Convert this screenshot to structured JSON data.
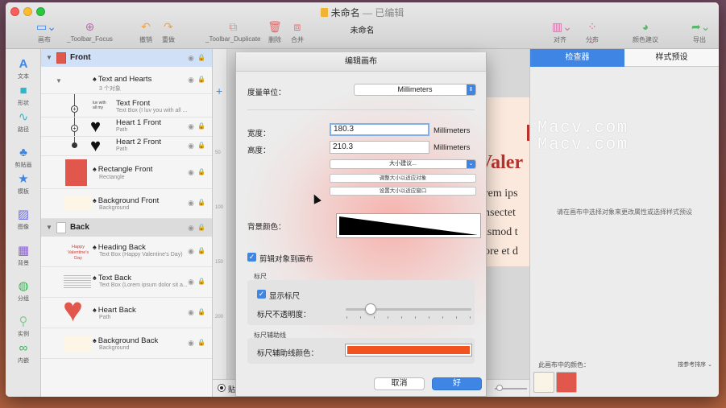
{
  "window": {
    "title": "未命名",
    "title_status": "— 已编辑",
    "doc_name": "未命名"
  },
  "toolbar": {
    "canvas": "画布",
    "focus": "_Toolbar_Focus",
    "undo": "撤销",
    "redo": "重做",
    "duplicate": "_Toolbar_Duplicate",
    "delete": "删除",
    "merge": "合并",
    "align": "对齐",
    "distribute": "分布",
    "color_suggest": "颜色建议",
    "export": "导出"
  },
  "rail": [
    {
      "label": "文本",
      "icon": "text-icon"
    },
    {
      "label": "形状",
      "icon": "shape-icon"
    },
    {
      "label": "路径",
      "icon": "path-icon"
    },
    {
      "label": "剪贴画",
      "icon": "clipart-icon"
    },
    {
      "label": "模板",
      "icon": "template-icon"
    },
    {
      "label": "图像",
      "icon": "image-icon"
    },
    {
      "label": "背景",
      "icon": "background-icon"
    },
    {
      "label": "分组",
      "icon": "group-icon"
    },
    {
      "label": "实例",
      "icon": "instance-icon"
    },
    {
      "label": "内嵌",
      "icon": "embed-icon"
    }
  ],
  "layers": {
    "front_group": "Front",
    "text_and_hearts": {
      "name": "Text and Hearts",
      "type": "3 个对象"
    },
    "text_front": {
      "name": "Text Front",
      "type": "Text Box (I luv you  with  all ..."
    },
    "heart1_front": {
      "name": "Heart 1 Front",
      "type": "Path"
    },
    "heart2_front": {
      "name": "Heart 2 Front",
      "type": "Path"
    },
    "rect_front": {
      "name": "Rectangle Front",
      "type": "Rectangle"
    },
    "bg_front": {
      "name": "Background Front",
      "type": "Background"
    },
    "back_group": "Back",
    "heading_back": {
      "name": "Heading Back",
      "type": "Text Box (Happy  Valentine's Day)"
    },
    "text_back": {
      "name": "Text Back",
      "type": "Text Box (Lorem ipsum dolor sit a..."
    },
    "heart_back": {
      "name": "Heart Back",
      "type": "Path"
    },
    "bg_back": {
      "name": "Background Back",
      "type": "Background"
    },
    "thumb_text": "luv with all my",
    "thumb_heading": "Happy Valentine's Day"
  },
  "canvas": {
    "preview_heading": "Valer",
    "preview_lines": [
      "orem ips",
      "onsectet",
      "iusmod t",
      "oore et d"
    ],
    "ruler_marks": [
      "50",
      "100",
      "150",
      "200"
    ],
    "bottom_radio": "贴"
  },
  "inspector": {
    "tab_inspector": "检查器",
    "tab_presets": "样式预设",
    "empty_hint": "请在画布中选择对象来更改属性或选择样式预设",
    "colors_label": "此画布中的颜色：",
    "sort_label": "按参考排序 ⌄",
    "swatches": [
      "#faf4e6",
      "#e2574c"
    ]
  },
  "watermark": [
    "Macv.com",
    "Macv.com"
  ],
  "dialog": {
    "title": "编辑画布",
    "unit_label": "度量单位：",
    "unit_value": "Millimeters",
    "width_label": "宽度：",
    "width_value": "180.3",
    "height_label": "高度：",
    "height_value": "210.3",
    "unit_suffix": "Millimeters",
    "size_suggest": "大小建议...",
    "fit_objects": "调整大小以适应对象",
    "fit_window": "设置大小以适应窗口",
    "bg_color_label": "背景颜色：",
    "clip_label": "剪辑对象到画布",
    "ruler_section": "标尺",
    "show_ruler": "显示标尺",
    "ruler_opacity_label": "标尺不透明度：",
    "ruler_opacity": 0.2,
    "guides_section": "标尺辅助线",
    "guides_color_label": "标尺辅助线颜色：",
    "guides_color": "#f2521d",
    "cancel": "取消",
    "ok": "好"
  }
}
